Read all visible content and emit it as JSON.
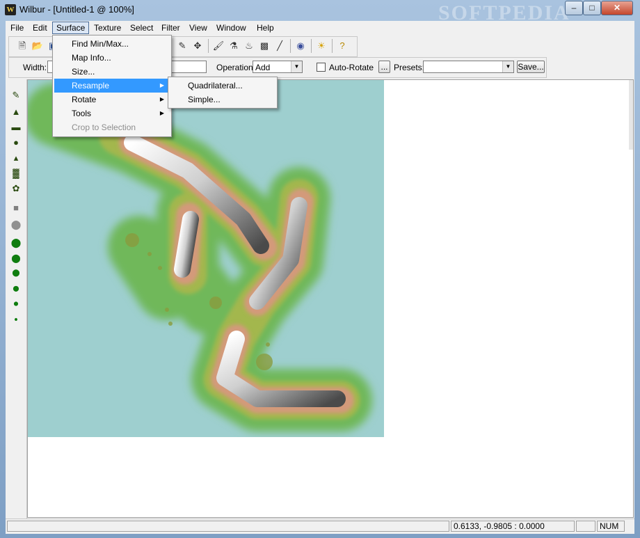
{
  "window": {
    "title": "Wilbur - [Untitled-1 @ 100%]",
    "app_icon": "W",
    "watermark": "SOFTPEDIA",
    "minimize": "–",
    "maximize": "□",
    "close": "✕"
  },
  "menubar": [
    "File",
    "Edit",
    "Surface",
    "Texture",
    "Select",
    "Filter",
    "View",
    "Window",
    "Help"
  ],
  "surface_menu": {
    "items": [
      {
        "label": "Find Min/Max...",
        "has_sub": false,
        "disabled": false
      },
      {
        "label": "Map Info...",
        "has_sub": false,
        "disabled": false
      },
      {
        "label": "Size...",
        "has_sub": false,
        "disabled": false
      },
      {
        "label": "Resample",
        "has_sub": true,
        "disabled": false
      },
      {
        "label": "Rotate",
        "has_sub": true,
        "disabled": false
      },
      {
        "label": "Tools",
        "has_sub": true,
        "disabled": false
      },
      {
        "label": "Crop to Selection",
        "has_sub": false,
        "disabled": true
      }
    ]
  },
  "resample_submenu": [
    "Quadrilateral...",
    "Simple..."
  ],
  "toolbar2": {
    "width_label": "Width:",
    "operation_label": "Operation:",
    "operation_value": "Add",
    "auto_rotate_label": "Auto-Rotate",
    "ellipsis_button": "...",
    "presets_label": "Presets:",
    "presets_value": "",
    "save_button": "Save..."
  },
  "status": {
    "coords": "0.6133, -0.9805 : 0.0000",
    "num": "NUM"
  },
  "colors": {
    "map_background": "#9ecfcf",
    "menu_highlight": "#3399ff"
  }
}
